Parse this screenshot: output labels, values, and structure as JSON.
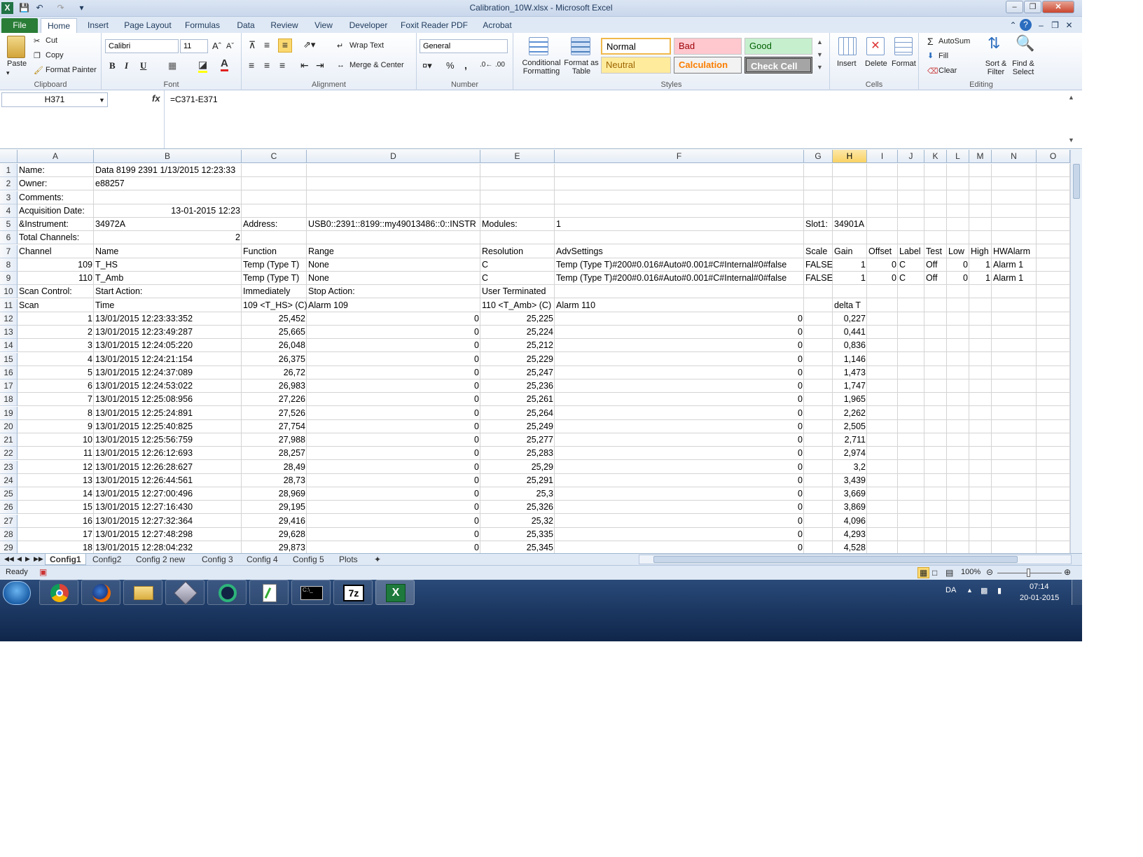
{
  "window": {
    "title": "Calibration_10W.xlsx  -  Microsoft Excel"
  },
  "tabs": [
    "File",
    "Home",
    "Insert",
    "Page Layout",
    "Formulas",
    "Data",
    "Review",
    "View",
    "Developer",
    "Foxit Reader PDF",
    "Acrobat"
  ],
  "ribbon": {
    "clipboard": {
      "label": "Clipboard",
      "paste": "Paste",
      "cut": "Cut",
      "copy": "Copy",
      "format_painter": "Format Painter"
    },
    "font": {
      "label": "Font",
      "name": "Calibri",
      "size": "11",
      "bold": "B",
      "italic": "I",
      "underline": "U"
    },
    "alignment": {
      "label": "Alignment",
      "wrap": "Wrap Text",
      "merge": "Merge & Center"
    },
    "number": {
      "label": "Number",
      "format": "General",
      "percent": "%",
      "comma": ","
    },
    "styles": {
      "label": "Styles",
      "conditional": "Conditional Formatting",
      "format_table": "Format as Table",
      "normal": "Normal",
      "bad": "Bad",
      "good": "Good",
      "neutral": "Neutral",
      "calculation": "Calculation",
      "check": "Check Cell"
    },
    "cells": {
      "label": "Cells",
      "insert": "Insert",
      "delete": "Delete",
      "format": "Format"
    },
    "editing": {
      "label": "Editing",
      "autosum": "AutoSum",
      "fill": "Fill",
      "clear": "Clear",
      "sort": "Sort & Filter",
      "find": "Find & Select"
    }
  },
  "formula_bar": {
    "name_box": "H371",
    "fx": "fx",
    "formula": "=C371-E371"
  },
  "columns": [
    "A",
    "B",
    "C",
    "D",
    "E",
    "F",
    "G",
    "H",
    "I",
    "J",
    "K",
    "L",
    "M",
    "N",
    "O"
  ],
  "rows": [
    {
      "n": "1",
      "A": "Name:",
      "B": "Data 8199 2391 1/13/2015 12:23:33"
    },
    {
      "n": "2",
      "A": "Owner:",
      "B": "e88257"
    },
    {
      "n": "3",
      "A": "Comments:"
    },
    {
      "n": "4",
      "A": "Acquisition Date:",
      "B": "13-01-2015 12:23"
    },
    {
      "n": "5",
      "A": "&Instrument:",
      "B": "34972A",
      "C": "Address:",
      "D": "USB0::2391::8199::my49013486::0::INSTR",
      "E": "Modules:",
      "F": "1",
      "G": "Slot1:",
      "H": "34901A"
    },
    {
      "n": "6",
      "A": "Total Channels:",
      "B": "2"
    },
    {
      "n": "7",
      "A": "Channel",
      "B": "Name",
      "C": "Function",
      "D": "Range",
      "E": "Resolution",
      "F": "AdvSettings",
      "G": "Scale",
      "H": "Gain",
      "I": "Offset",
      "J": "Label",
      "K": "Test",
      "L": "Low",
      "M": "High",
      "N": "HWAlarm"
    },
    {
      "n": "8",
      "A": "109",
      "B": "T_HS",
      "C": "Temp (Type T)",
      "D": "None",
      "E": "C",
      "F": "Temp (Type T)#200#0.016#Auto#0.001#C#Internal#0#false",
      "G": "FALSE",
      "H": "1",
      "I": "0",
      "J": "C",
      "K": "Off",
      "L": "0",
      "M": "1",
      "N": "Alarm 1"
    },
    {
      "n": "9",
      "A": "110",
      "B": "T_Amb",
      "C": "Temp (Type T)",
      "D": "None",
      "E": "C",
      "F": "Temp (Type T)#200#0.016#Auto#0.001#C#Internal#0#false",
      "G": "FALSE",
      "H": "1",
      "I": "0",
      "J": "C",
      "K": "Off",
      "L": "0",
      "M": "1",
      "N": "Alarm 1"
    },
    {
      "n": "10",
      "A": "Scan  Control:",
      "B": "Start Action:",
      "C": "Immediately",
      "D": "Stop Action:",
      "E": "User Terminated"
    },
    {
      "n": "11",
      "A": "Scan",
      "B": "Time",
      "C": "109 <T_HS> (C)",
      "D": "Alarm 109",
      "E": "110 <T_Amb> (C)",
      "F": "Alarm 110",
      "H": "delta T"
    },
    {
      "n": "12",
      "A": "1",
      "B": "13/01/2015 12:23:33:352",
      "C": "25,452",
      "D": "0",
      "E": "25,225",
      "F": "0",
      "H": "0,227"
    },
    {
      "n": "13",
      "A": "2",
      "B": "13/01/2015 12:23:49:287",
      "C": "25,665",
      "D": "0",
      "E": "25,224",
      "F": "0",
      "H": "0,441"
    },
    {
      "n": "14",
      "A": "3",
      "B": "13/01/2015 12:24:05:220",
      "C": "26,048",
      "D": "0",
      "E": "25,212",
      "F": "0",
      "H": "0,836"
    },
    {
      "n": "15",
      "A": "4",
      "B": "13/01/2015 12:24:21:154",
      "C": "26,375",
      "D": "0",
      "E": "25,229",
      "F": "0",
      "H": "1,146"
    },
    {
      "n": "16",
      "A": "5",
      "B": "13/01/2015 12:24:37:089",
      "C": "26,72",
      "D": "0",
      "E": "25,247",
      "F": "0",
      "H": "1,473"
    },
    {
      "n": "17",
      "A": "6",
      "B": "13/01/2015 12:24:53:022",
      "C": "26,983",
      "D": "0",
      "E": "25,236",
      "F": "0",
      "H": "1,747"
    },
    {
      "n": "18",
      "A": "7",
      "B": "13/01/2015 12:25:08:956",
      "C": "27,226",
      "D": "0",
      "E": "25,261",
      "F": "0",
      "H": "1,965"
    },
    {
      "n": "19",
      "A": "8",
      "B": "13/01/2015 12:25:24:891",
      "C": "27,526",
      "D": "0",
      "E": "25,264",
      "F": "0",
      "H": "2,262"
    },
    {
      "n": "20",
      "A": "9",
      "B": "13/01/2015 12:25:40:825",
      "C": "27,754",
      "D": "0",
      "E": "25,249",
      "F": "0",
      "H": "2,505"
    },
    {
      "n": "21",
      "A": "10",
      "B": "13/01/2015 12:25:56:759",
      "C": "27,988",
      "D": "0",
      "E": "25,277",
      "F": "0",
      "H": "2,711"
    },
    {
      "n": "22",
      "A": "11",
      "B": "13/01/2015 12:26:12:693",
      "C": "28,257",
      "D": "0",
      "E": "25,283",
      "F": "0",
      "H": "2,974"
    },
    {
      "n": "23",
      "A": "12",
      "B": "13/01/2015 12:26:28:627",
      "C": "28,49",
      "D": "0",
      "E": "25,29",
      "F": "0",
      "H": "3,2"
    },
    {
      "n": "24",
      "A": "13",
      "B": "13/01/2015 12:26:44:561",
      "C": "28,73",
      "D": "0",
      "E": "25,291",
      "F": "0",
      "H": "3,439"
    },
    {
      "n": "25",
      "A": "14",
      "B": "13/01/2015 12:27:00:496",
      "C": "28,969",
      "D": "0",
      "E": "25,3",
      "F": "0",
      "H": "3,669"
    },
    {
      "n": "26",
      "A": "15",
      "B": "13/01/2015 12:27:16:430",
      "C": "29,195",
      "D": "0",
      "E": "25,326",
      "F": "0",
      "H": "3,869"
    },
    {
      "n": "27",
      "A": "16",
      "B": "13/01/2015 12:27:32:364",
      "C": "29,416",
      "D": "0",
      "E": "25,32",
      "F": "0",
      "H": "4,096"
    },
    {
      "n": "28",
      "A": "17",
      "B": "13/01/2015 12:27:48:298",
      "C": "29,628",
      "D": "0",
      "E": "25,335",
      "F": "0",
      "H": "4,293"
    },
    {
      "n": "29",
      "A": "18",
      "B": "13/01/2015 12:28:04:232",
      "C": "29,873",
      "D": "0",
      "E": "25,345",
      "F": "0",
      "H": "4,528"
    }
  ],
  "sheets": [
    "Config1",
    "Config2",
    "Config 2 new",
    "Config 3",
    "Config 4",
    "Config 5",
    "Plots"
  ],
  "status": {
    "ready": "Ready",
    "zoom": "100%"
  },
  "taskbar": {
    "lang": "DA",
    "time": "07:14",
    "date": "20-01-2015"
  }
}
